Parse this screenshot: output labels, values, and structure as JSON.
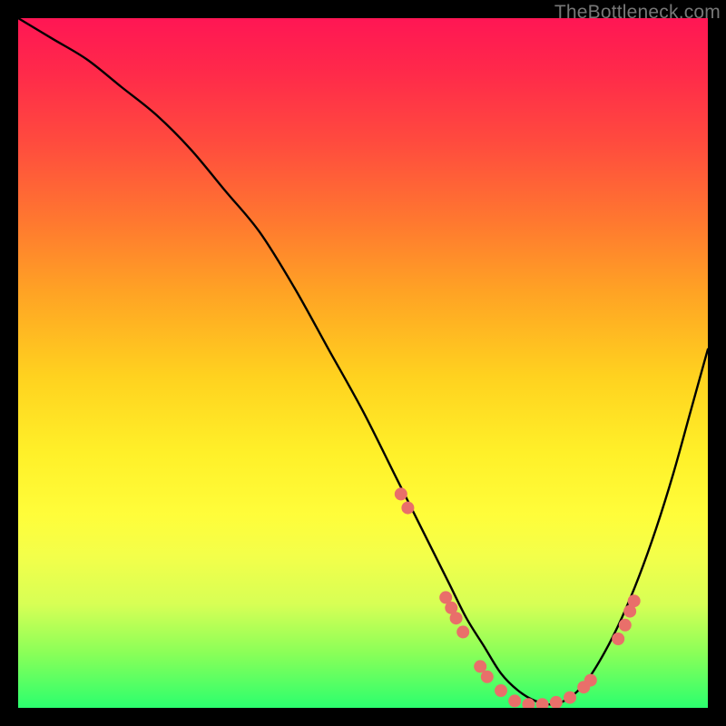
{
  "watermark": "TheBottleneck.com",
  "chart_data": {
    "type": "line",
    "title": "",
    "xlabel": "",
    "ylabel": "",
    "xlim": [
      0,
      100
    ],
    "ylim": [
      0,
      100
    ],
    "series": [
      {
        "name": "curve",
        "x": [
          0,
          5,
          10,
          15,
          20,
          25,
          30,
          35,
          40,
          45,
          50,
          55,
          60,
          62.5,
          65,
          67.5,
          70,
          72.5,
          75,
          77.5,
          80,
          82.5,
          85,
          87.5,
          90,
          92.5,
          95,
          97.5,
          100
        ],
        "y": [
          100,
          97,
          94,
          90,
          86,
          81,
          75,
          69,
          61,
          52,
          43,
          33,
          23,
          18,
          13,
          9,
          5,
          2.5,
          1,
          0.5,
          1.5,
          4,
          8,
          13,
          19,
          26,
          34,
          43,
          52
        ]
      }
    ],
    "markers": {
      "name": "dots",
      "color": "#e96f6a",
      "points": [
        {
          "x": 55.5,
          "y": 31
        },
        {
          "x": 56.5,
          "y": 29
        },
        {
          "x": 62,
          "y": 16
        },
        {
          "x": 62.8,
          "y": 14.5
        },
        {
          "x": 63.5,
          "y": 13
        },
        {
          "x": 64.5,
          "y": 11
        },
        {
          "x": 67,
          "y": 6
        },
        {
          "x": 68,
          "y": 4.5
        },
        {
          "x": 70,
          "y": 2.5
        },
        {
          "x": 72,
          "y": 1
        },
        {
          "x": 74,
          "y": 0.5
        },
        {
          "x": 76,
          "y": 0.5
        },
        {
          "x": 78,
          "y": 0.8
        },
        {
          "x": 80,
          "y": 1.5
        },
        {
          "x": 82,
          "y": 3
        },
        {
          "x": 83,
          "y": 4
        },
        {
          "x": 87,
          "y": 10
        },
        {
          "x": 88,
          "y": 12
        },
        {
          "x": 88.7,
          "y": 14
        },
        {
          "x": 89.3,
          "y": 15.5
        }
      ]
    },
    "gradient_stops": [
      {
        "pos": 0,
        "color": "#ff1654"
      },
      {
        "pos": 30,
        "color": "#ff7a2f"
      },
      {
        "pos": 63,
        "color": "#fff029"
      },
      {
        "pos": 100,
        "color": "#2bff6e"
      }
    ]
  }
}
